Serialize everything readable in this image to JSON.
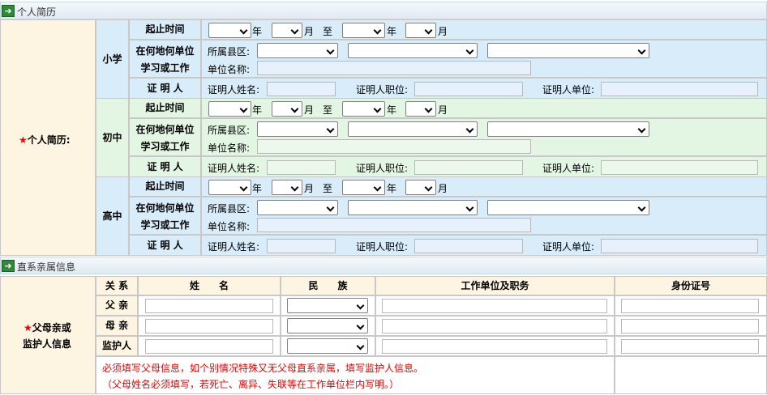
{
  "sections": {
    "resume": "个人简历",
    "family": "直系亲属信息"
  },
  "resume": {
    "label_star": "★",
    "label": "个人简历:",
    "stages": [
      {
        "name": "小学"
      },
      {
        "name": "初中"
      },
      {
        "name": "高中"
      }
    ],
    "row_period": "起止时间",
    "row_place_1": "在何地何单位",
    "row_place_2": "学习或工作",
    "row_witness": "证 明 人",
    "year": "年",
    "month": "月",
    "to": "至",
    "county": "所属县区:",
    "unit": "单位名称:",
    "witness_name": "证明人姓名:",
    "witness_pos": "证明人职位:",
    "witness_unit": "证明人单位:"
  },
  "family": {
    "label_star": "★",
    "label_1": "父母亲或",
    "label_2": "监护人信息",
    "headers": {
      "relation": "关 系",
      "name": "姓　　名",
      "ethnic": "民　　族",
      "work": "工作单位及职务",
      "id": "身份证号"
    },
    "rows": [
      {
        "relation": "父 亲"
      },
      {
        "relation": "母 亲"
      },
      {
        "relation": "监护人"
      }
    ],
    "note_1": "必须填写父母信息，如个别情况特殊又无父母直系亲属，填写监护人信息。",
    "note_2": "（父母姓名必须填写，若死亡、离异、失联等在工作单位栏内写明。）"
  }
}
